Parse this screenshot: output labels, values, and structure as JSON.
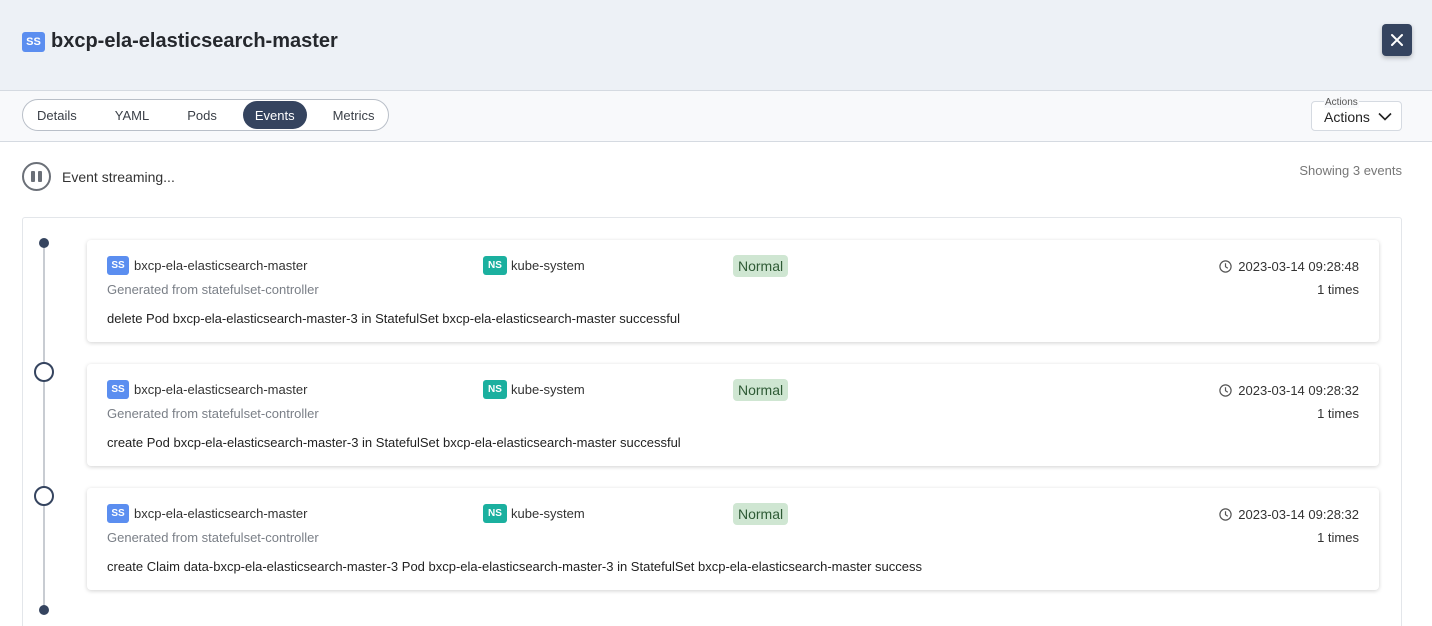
{
  "header": {
    "badge": "SS",
    "title": "bxcp-ela-elasticsearch-master"
  },
  "tabs": [
    {
      "label": "Details",
      "active": false
    },
    {
      "label": "YAML",
      "active": false
    },
    {
      "label": "Pods",
      "active": false
    },
    {
      "label": "Events",
      "active": true
    },
    {
      "label": "Metrics",
      "active": false
    }
  ],
  "actions": {
    "float_label": "Actions",
    "label": "Actions"
  },
  "stream": {
    "status": "Event streaming...",
    "count_text": "Showing 3 events"
  },
  "events": [
    {
      "kind_badge": "SS",
      "resource": "bxcp-ela-elasticsearch-master",
      "ns_badge": "NS",
      "namespace": "kube-system",
      "type": "Normal",
      "timestamp": "2023-03-14 09:28:48",
      "count": "1 times",
      "source": "Generated from statefulset-controller",
      "message": "delete Pod bxcp-ela-elasticsearch-master-3 in StatefulSet bxcp-ela-elasticsearch-master successful"
    },
    {
      "kind_badge": "SS",
      "resource": "bxcp-ela-elasticsearch-master",
      "ns_badge": "NS",
      "namespace": "kube-system",
      "type": "Normal",
      "timestamp": "2023-03-14 09:28:32",
      "count": "1 times",
      "source": "Generated from statefulset-controller",
      "message": "create Pod bxcp-ela-elasticsearch-master-3 in StatefulSet bxcp-ela-elasticsearch-master successful"
    },
    {
      "kind_badge": "SS",
      "resource": "bxcp-ela-elasticsearch-master",
      "ns_badge": "NS",
      "namespace": "kube-system",
      "type": "Normal",
      "timestamp": "2023-03-14 09:28:32",
      "count": "1 times",
      "source": "Generated from statefulset-controller",
      "message": "create Claim data-bxcp-ela-elasticsearch-master-3 Pod bxcp-ela-elasticsearch-master-3 in StatefulSet bxcp-ela-elasticsearch-master success"
    }
  ],
  "colors": {
    "primary_dark": "#35445f",
    "ss_badge": "#5b8ef0",
    "ns_badge": "#1bb09f",
    "status_bg": "#cfe6d2"
  },
  "icons": {
    "close": "close-icon",
    "pause": "pause-icon",
    "clock": "clock-icon",
    "chevron": "chevron-down-icon"
  }
}
